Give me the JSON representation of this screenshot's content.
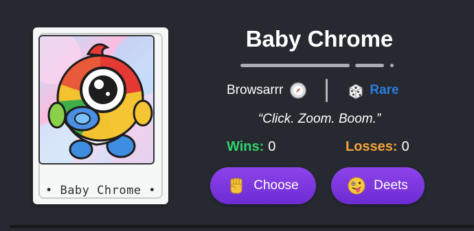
{
  "card": {
    "caption": "Baby Chrome",
    "caption_dot": "•"
  },
  "info": {
    "title": "Baby Chrome",
    "browser_type": "Browsarrr",
    "browser_type_icon": "compass-icon",
    "rarity_icon": "dice-icon",
    "rarity": "Rare",
    "quote": "“Click. Zoom. Boom.”"
  },
  "stats": {
    "wins_label": "Wins:",
    "wins_value": "0",
    "losses_label": "Losses:",
    "losses_value": "0"
  },
  "actions": {
    "choose_label": "Choose",
    "choose_icon": "raised-fist-icon",
    "deets_label": "Deets",
    "deets_icon": "zany-face-icon"
  },
  "colors": {
    "background": "#262930",
    "wins": "#2fd36a",
    "losses": "#f4a43a",
    "rarity": "#2b7de0",
    "button": "#7a35de"
  }
}
